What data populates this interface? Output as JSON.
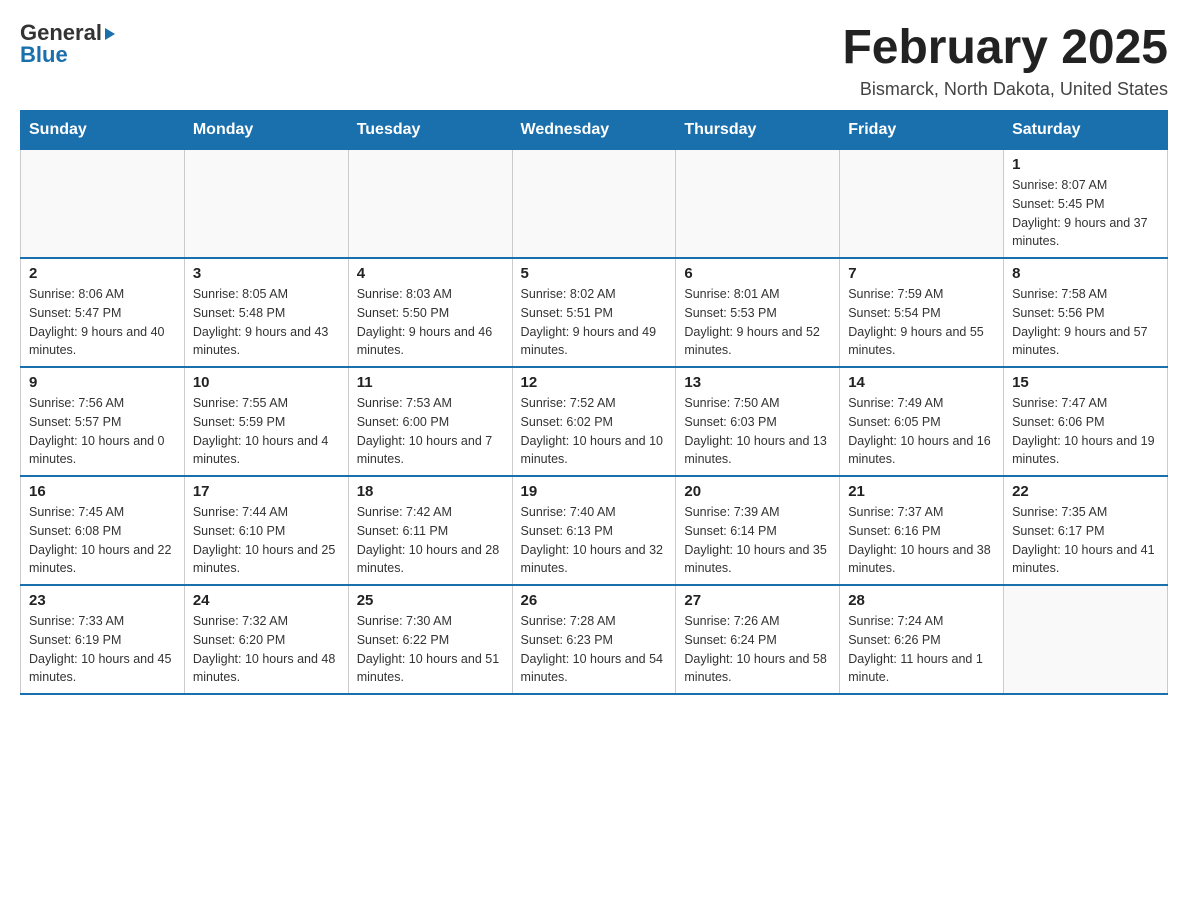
{
  "logo": {
    "general": "General",
    "blue": "Blue"
  },
  "title": "February 2025",
  "subtitle": "Bismarck, North Dakota, United States",
  "headers": [
    "Sunday",
    "Monday",
    "Tuesday",
    "Wednesday",
    "Thursday",
    "Friday",
    "Saturday"
  ],
  "weeks": [
    [
      {
        "day": "",
        "info": ""
      },
      {
        "day": "",
        "info": ""
      },
      {
        "day": "",
        "info": ""
      },
      {
        "day": "",
        "info": ""
      },
      {
        "day": "",
        "info": ""
      },
      {
        "day": "",
        "info": ""
      },
      {
        "day": "1",
        "info": "Sunrise: 8:07 AM\nSunset: 5:45 PM\nDaylight: 9 hours and 37 minutes."
      }
    ],
    [
      {
        "day": "2",
        "info": "Sunrise: 8:06 AM\nSunset: 5:47 PM\nDaylight: 9 hours and 40 minutes."
      },
      {
        "day": "3",
        "info": "Sunrise: 8:05 AM\nSunset: 5:48 PM\nDaylight: 9 hours and 43 minutes."
      },
      {
        "day": "4",
        "info": "Sunrise: 8:03 AM\nSunset: 5:50 PM\nDaylight: 9 hours and 46 minutes."
      },
      {
        "day": "5",
        "info": "Sunrise: 8:02 AM\nSunset: 5:51 PM\nDaylight: 9 hours and 49 minutes."
      },
      {
        "day": "6",
        "info": "Sunrise: 8:01 AM\nSunset: 5:53 PM\nDaylight: 9 hours and 52 minutes."
      },
      {
        "day": "7",
        "info": "Sunrise: 7:59 AM\nSunset: 5:54 PM\nDaylight: 9 hours and 55 minutes."
      },
      {
        "day": "8",
        "info": "Sunrise: 7:58 AM\nSunset: 5:56 PM\nDaylight: 9 hours and 57 minutes."
      }
    ],
    [
      {
        "day": "9",
        "info": "Sunrise: 7:56 AM\nSunset: 5:57 PM\nDaylight: 10 hours and 0 minutes."
      },
      {
        "day": "10",
        "info": "Sunrise: 7:55 AM\nSunset: 5:59 PM\nDaylight: 10 hours and 4 minutes."
      },
      {
        "day": "11",
        "info": "Sunrise: 7:53 AM\nSunset: 6:00 PM\nDaylight: 10 hours and 7 minutes."
      },
      {
        "day": "12",
        "info": "Sunrise: 7:52 AM\nSunset: 6:02 PM\nDaylight: 10 hours and 10 minutes."
      },
      {
        "day": "13",
        "info": "Sunrise: 7:50 AM\nSunset: 6:03 PM\nDaylight: 10 hours and 13 minutes."
      },
      {
        "day": "14",
        "info": "Sunrise: 7:49 AM\nSunset: 6:05 PM\nDaylight: 10 hours and 16 minutes."
      },
      {
        "day": "15",
        "info": "Sunrise: 7:47 AM\nSunset: 6:06 PM\nDaylight: 10 hours and 19 minutes."
      }
    ],
    [
      {
        "day": "16",
        "info": "Sunrise: 7:45 AM\nSunset: 6:08 PM\nDaylight: 10 hours and 22 minutes."
      },
      {
        "day": "17",
        "info": "Sunrise: 7:44 AM\nSunset: 6:10 PM\nDaylight: 10 hours and 25 minutes."
      },
      {
        "day": "18",
        "info": "Sunrise: 7:42 AM\nSunset: 6:11 PM\nDaylight: 10 hours and 28 minutes."
      },
      {
        "day": "19",
        "info": "Sunrise: 7:40 AM\nSunset: 6:13 PM\nDaylight: 10 hours and 32 minutes."
      },
      {
        "day": "20",
        "info": "Sunrise: 7:39 AM\nSunset: 6:14 PM\nDaylight: 10 hours and 35 minutes."
      },
      {
        "day": "21",
        "info": "Sunrise: 7:37 AM\nSunset: 6:16 PM\nDaylight: 10 hours and 38 minutes."
      },
      {
        "day": "22",
        "info": "Sunrise: 7:35 AM\nSunset: 6:17 PM\nDaylight: 10 hours and 41 minutes."
      }
    ],
    [
      {
        "day": "23",
        "info": "Sunrise: 7:33 AM\nSunset: 6:19 PM\nDaylight: 10 hours and 45 minutes."
      },
      {
        "day": "24",
        "info": "Sunrise: 7:32 AM\nSunset: 6:20 PM\nDaylight: 10 hours and 48 minutes."
      },
      {
        "day": "25",
        "info": "Sunrise: 7:30 AM\nSunset: 6:22 PM\nDaylight: 10 hours and 51 minutes."
      },
      {
        "day": "26",
        "info": "Sunrise: 7:28 AM\nSunset: 6:23 PM\nDaylight: 10 hours and 54 minutes."
      },
      {
        "day": "27",
        "info": "Sunrise: 7:26 AM\nSunset: 6:24 PM\nDaylight: 10 hours and 58 minutes."
      },
      {
        "day": "28",
        "info": "Sunrise: 7:24 AM\nSunset: 6:26 PM\nDaylight: 11 hours and 1 minute."
      },
      {
        "day": "",
        "info": ""
      }
    ]
  ]
}
